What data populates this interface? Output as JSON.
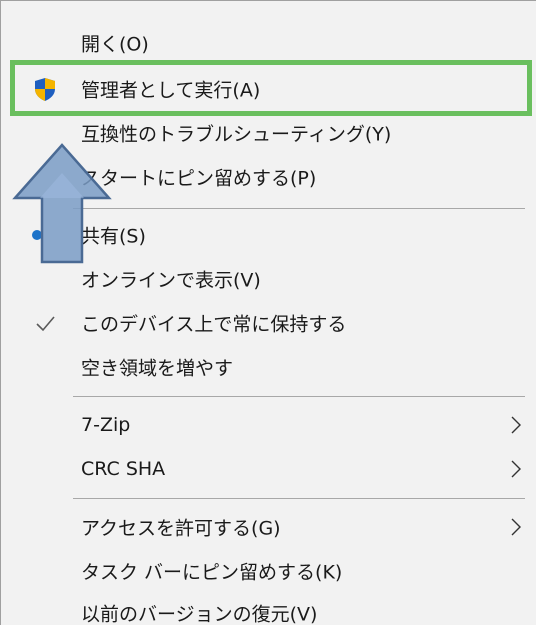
{
  "menu": {
    "items": [
      {
        "label": "開く(O)",
        "icon": "none",
        "submenu": false
      },
      {
        "label": "管理者として実行(A)",
        "icon": "uac-shield-icon",
        "submenu": false
      },
      {
        "label": "互換性のトラブルシューティング(Y)",
        "icon": "none",
        "submenu": false
      },
      {
        "label": "スタートにピン留めする(P)",
        "icon": "none",
        "submenu": false
      },
      {
        "label": "共有(S)",
        "icon": "share-icon",
        "submenu": false
      },
      {
        "label": "オンラインで表示(V)",
        "icon": "none",
        "submenu": false
      },
      {
        "label": "このデバイス上で常に保持する",
        "icon": "checkmark-icon",
        "submenu": false
      },
      {
        "label": "空き領域を増やす",
        "icon": "none",
        "submenu": false
      },
      {
        "label": "7-Zip",
        "icon": "none",
        "submenu": true
      },
      {
        "label": "CRC SHA",
        "icon": "none",
        "submenu": true
      },
      {
        "label": "アクセスを許可する(G)",
        "icon": "none",
        "submenu": true
      },
      {
        "label": "タスク バーにピン留めする(K)",
        "icon": "none",
        "submenu": false
      },
      {
        "label": "以前のバージョンの復元(V)",
        "icon": "none",
        "submenu": false
      }
    ]
  },
  "annotation": {
    "highlight_color": "#6abf5e",
    "arrow_color": "#7a9cc6"
  }
}
